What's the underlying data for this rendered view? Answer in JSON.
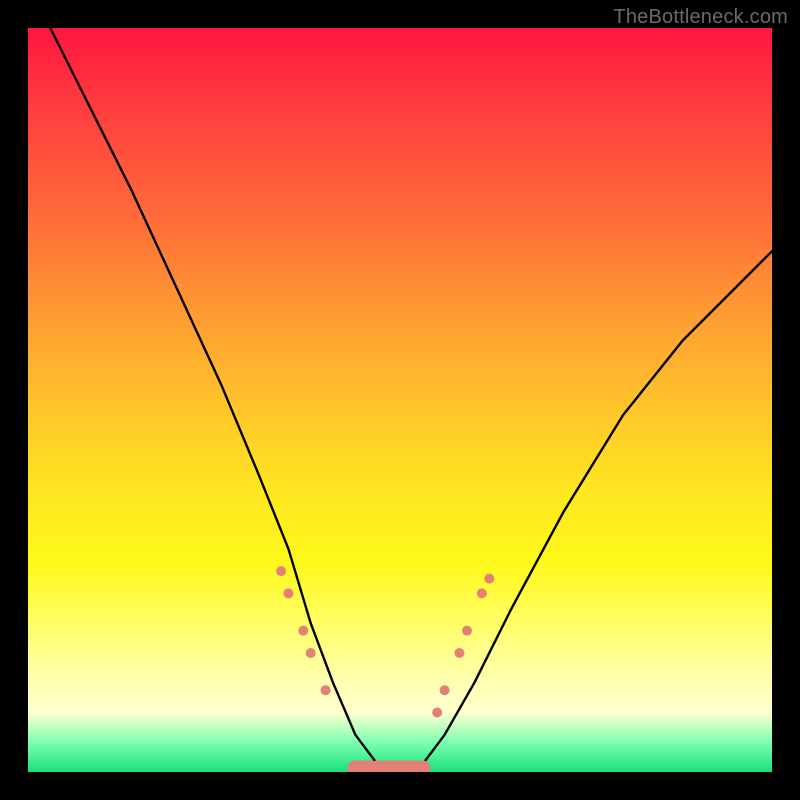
{
  "watermark": "TheBottleneck.com",
  "chart_data": {
    "type": "line",
    "title": "",
    "xlabel": "",
    "ylabel": "",
    "xlim": [
      0,
      100
    ],
    "ylim": [
      0,
      100
    ],
    "grid": false,
    "legend": false,
    "background_gradient": {
      "orientation": "vertical",
      "stops": [
        {
          "pos": 0.0,
          "color": "#ff163f"
        },
        {
          "pos": 0.25,
          "color": "#ff6a3a"
        },
        {
          "pos": 0.5,
          "color": "#ffc82a"
        },
        {
          "pos": 0.8,
          "color": "#ffff80"
        },
        {
          "pos": 0.95,
          "color": "#a8ffb8"
        },
        {
          "pos": 1.0,
          "color": "#18e07c"
        }
      ]
    },
    "series": [
      {
        "name": "bottleneck-curve",
        "color": "#000000",
        "x": [
          3,
          8,
          14,
          20,
          26,
          31,
          35,
          38,
          41,
          44,
          47,
          50,
          53,
          56,
          60,
          65,
          72,
          80,
          88,
          96,
          100
        ],
        "values": [
          100,
          90,
          78,
          65,
          52,
          40,
          30,
          20,
          12,
          5,
          1,
          0,
          1,
          5,
          12,
          22,
          35,
          48,
          58,
          66,
          70
        ]
      }
    ],
    "markers": {
      "color": "#e58076",
      "radius_small": 5,
      "radius_large": 8,
      "points_on_curve": [
        {
          "x": 34,
          "y": 27
        },
        {
          "x": 35,
          "y": 24
        },
        {
          "x": 37,
          "y": 19
        },
        {
          "x": 38,
          "y": 16
        },
        {
          "x": 40,
          "y": 11
        },
        {
          "x": 55,
          "y": 8
        },
        {
          "x": 56,
          "y": 11
        },
        {
          "x": 58,
          "y": 16
        },
        {
          "x": 59,
          "y": 19
        },
        {
          "x": 61,
          "y": 24
        },
        {
          "x": 62,
          "y": 26
        }
      ],
      "bottom_cluster": {
        "x_start": 44,
        "x_end": 53,
        "y": 0.5
      }
    }
  }
}
